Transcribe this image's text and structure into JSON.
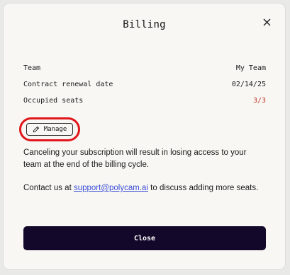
{
  "dialog": {
    "title": "Billing",
    "close_icon": "close-icon"
  },
  "details": [
    {
      "label": "Team",
      "value": "My Team"
    },
    {
      "label": "Contract renewal date",
      "value": "02/14/25"
    },
    {
      "label": "Occupied seats",
      "value": "3/3"
    }
  ],
  "manage": {
    "label": "Manage",
    "icon": "pencil-icon"
  },
  "notice": "Canceling your subscription will result in losing access to your team at the end of the billing cycle.",
  "contact": {
    "prefix": "Contact us at ",
    "email": "support@polycam.ai",
    "suffix": " to discuss adding more seats."
  },
  "footer": {
    "close_label": "Close"
  },
  "colors": {
    "highlight": "#e0161b",
    "warning": "#c0392b",
    "primary_button": "#14082a",
    "link": "#3b4fd8"
  }
}
